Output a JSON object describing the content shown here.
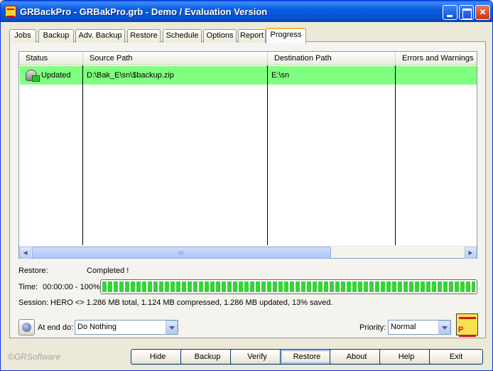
{
  "window": {
    "title": "GRBackPro - GRBakPro.grb - Demo / Evaluation Version"
  },
  "tabs": [
    {
      "label": "Jobs"
    },
    {
      "label": "Backup"
    },
    {
      "label": "Adv. Backup"
    },
    {
      "label": "Restore"
    },
    {
      "label": "Schedule"
    },
    {
      "label": "Options"
    },
    {
      "label": "Report"
    },
    {
      "label": "Progress",
      "active": true
    }
  ],
  "listview": {
    "columns": [
      {
        "label": "Status"
      },
      {
        "label": "Source Path"
      },
      {
        "label": "Destination Path"
      },
      {
        "label": "Errors and Warnings"
      }
    ],
    "rows": [
      {
        "status": "Updated",
        "source": "D:\\Bak_E\\sn\\$backup.zip",
        "destination": "E:\\sn",
        "errors": ""
      }
    ]
  },
  "info": {
    "restore_label": "Restore:",
    "restore_value": "Completed !",
    "time_label": "Time:",
    "time_value": "00:00:00 - 100%",
    "progress_fraction": 1.0,
    "session_label": "Session:",
    "session_value": "HERO <>  1.286 MB total,  1.124 MB compressed,  1.286 MB updated, 13% saved."
  },
  "end": {
    "label": "At end do:",
    "selected": "Do Nothing"
  },
  "priority": {
    "label": "Priority:",
    "selected": "Normal"
  },
  "copyright": "©GRSoftware",
  "buttons": {
    "hide": "Hide",
    "backup": "Backup",
    "verify": "Verify",
    "restore": "Restore",
    "about": "About",
    "help": "Help",
    "exit": "Exit"
  },
  "colors": {
    "row_highlight": "#80ff80",
    "progress_green": "#37d337",
    "title_blue": "#0a5fe8"
  }
}
